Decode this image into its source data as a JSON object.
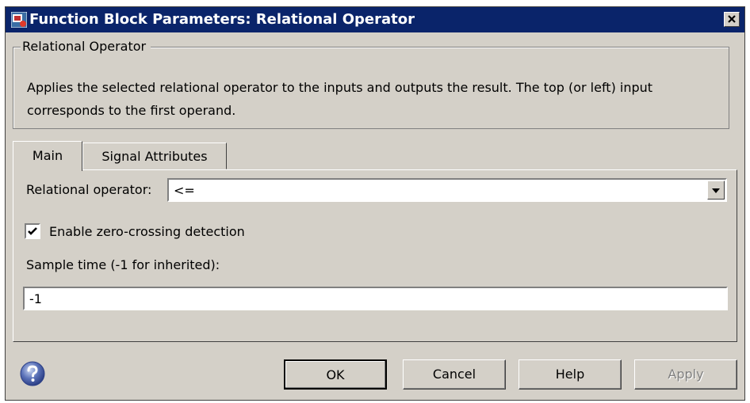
{
  "window": {
    "title": "Function Block Parameters: Relational Operator"
  },
  "group": {
    "legend": "Relational Operator",
    "description": "Applies the selected relational operator to the inputs and outputs the result. The top (or left) input corresponds to the first operand."
  },
  "tabs": [
    {
      "label": "Main",
      "active": true
    },
    {
      "label": "Signal Attributes",
      "active": false
    }
  ],
  "main": {
    "operator_label": "Relational operator:",
    "operator_value": "<=",
    "zero_crossing_label": "Enable zero-crossing detection",
    "zero_crossing_checked": true,
    "sample_time_label": "Sample time (-1 for inherited):",
    "sample_time_value": "-1"
  },
  "buttons": {
    "ok": "OK",
    "cancel": "Cancel",
    "help": "Help",
    "apply": "Apply"
  },
  "icons": {
    "app": "simulink-block-icon",
    "close": "close-icon",
    "dropdown": "chevron-down-icon",
    "check": "check-icon",
    "help": "question-icon"
  },
  "colors": {
    "titlebar": "#0a246a",
    "dialog_bg": "#d4d0c8"
  }
}
